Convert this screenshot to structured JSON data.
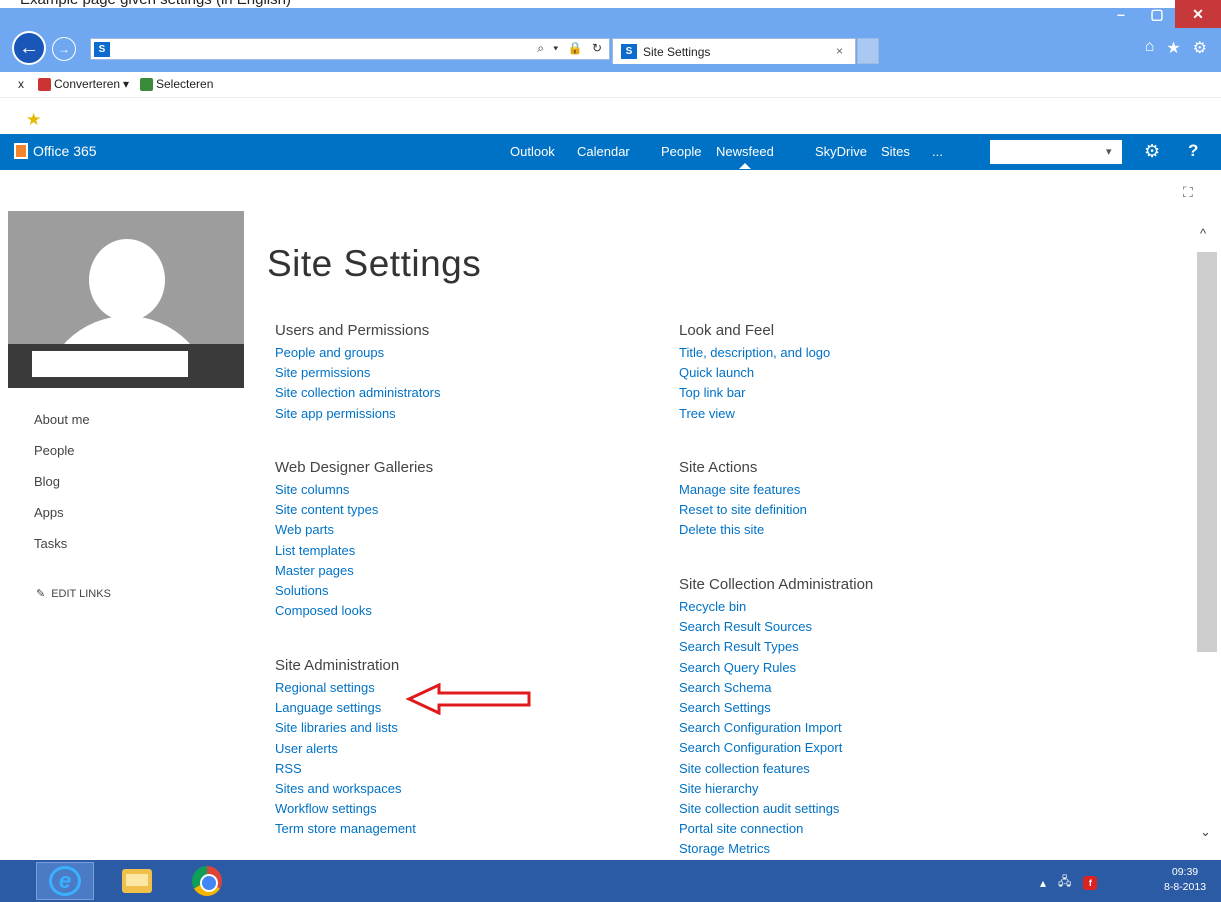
{
  "caption": "Example page given settings (in English)",
  "browser": {
    "window_controls": [
      "–",
      "▢",
      "✕"
    ],
    "back_glyph": "←",
    "forward_glyph": "→",
    "address_value": "",
    "address_tools": "⌕ ▾ 🔒 ↻",
    "tab_title": "Site Settings",
    "tab_close": "×",
    "home_glyph": "⌂",
    "favorites_glyph": "★",
    "tools_glyph": "⚙"
  },
  "command_bar": {
    "close": "x",
    "convert_label": "Converteren",
    "dropdown": "▾",
    "select_label": "Selecteren"
  },
  "suite": {
    "logo_text": "Office 365",
    "nav": [
      "Outlook",
      "Calendar",
      "People",
      "Newsfeed",
      "SkyDrive",
      "Sites",
      "..."
    ],
    "active_nav": "Newsfeed",
    "user_name": "",
    "user_arrow": "▾",
    "settings_glyph": "⚙",
    "help_glyph": "?"
  },
  "focus_glyph": "⛶",
  "profile": {
    "name": "",
    "nav": [
      "About me",
      "People",
      "Blog",
      "Apps",
      "Tasks"
    ],
    "edit_links_icon": "✎",
    "edit_links": "EDIT LINKS"
  },
  "page": {
    "title": "Site Settings",
    "sections": {
      "users_permissions": {
        "heading": "Users and Permissions",
        "links": [
          "People and groups",
          "Site permissions",
          "Site collection administrators",
          "Site app permissions"
        ]
      },
      "web_designer_galleries": {
        "heading": "Web Designer Galleries",
        "links": [
          "Site columns",
          "Site content types",
          "Web parts",
          "List templates",
          "Master pages",
          "Solutions",
          "Composed looks"
        ]
      },
      "site_administration": {
        "heading": "Site Administration",
        "links": [
          "Regional settings",
          "Language settings",
          "Site libraries and lists",
          "User alerts",
          "RSS",
          "Sites and workspaces",
          "Workflow settings",
          "Term store management"
        ]
      },
      "look_and_feel": {
        "heading": "Look and Feel",
        "links": [
          "Title, description, and logo",
          "Quick launch",
          "Top link bar",
          "Tree view"
        ]
      },
      "site_actions": {
        "heading": "Site Actions",
        "links": [
          "Manage site features",
          "Reset to site definition",
          "Delete this site"
        ]
      },
      "site_collection_admin": {
        "heading": "Site Collection Administration",
        "links": [
          "Recycle bin",
          "Search Result Sources",
          "Search Result Types",
          "Search Query Rules",
          "Search Schema",
          "Search Settings",
          "Search Configuration Import",
          "Search Configuration Export",
          "Site collection features",
          "Site hierarchy",
          "Site collection audit settings",
          "Portal site connection",
          "Storage Metrics"
        ]
      }
    }
  },
  "scrollbar": {
    "up": "^",
    "down": "⌄"
  },
  "taskbar": {
    "ie_glyph": "e",
    "tray": [
      "▴",
      "🖧"
    ],
    "flash": "f",
    "time": "09:39",
    "date": "8-8-2013"
  },
  "colors": {
    "suite_bar": "#0072c6",
    "link": "#0072c6",
    "chrome": "#6fa8f0",
    "taskbar": "#2c5ba6",
    "annotation_arrow": "#e0191b"
  }
}
